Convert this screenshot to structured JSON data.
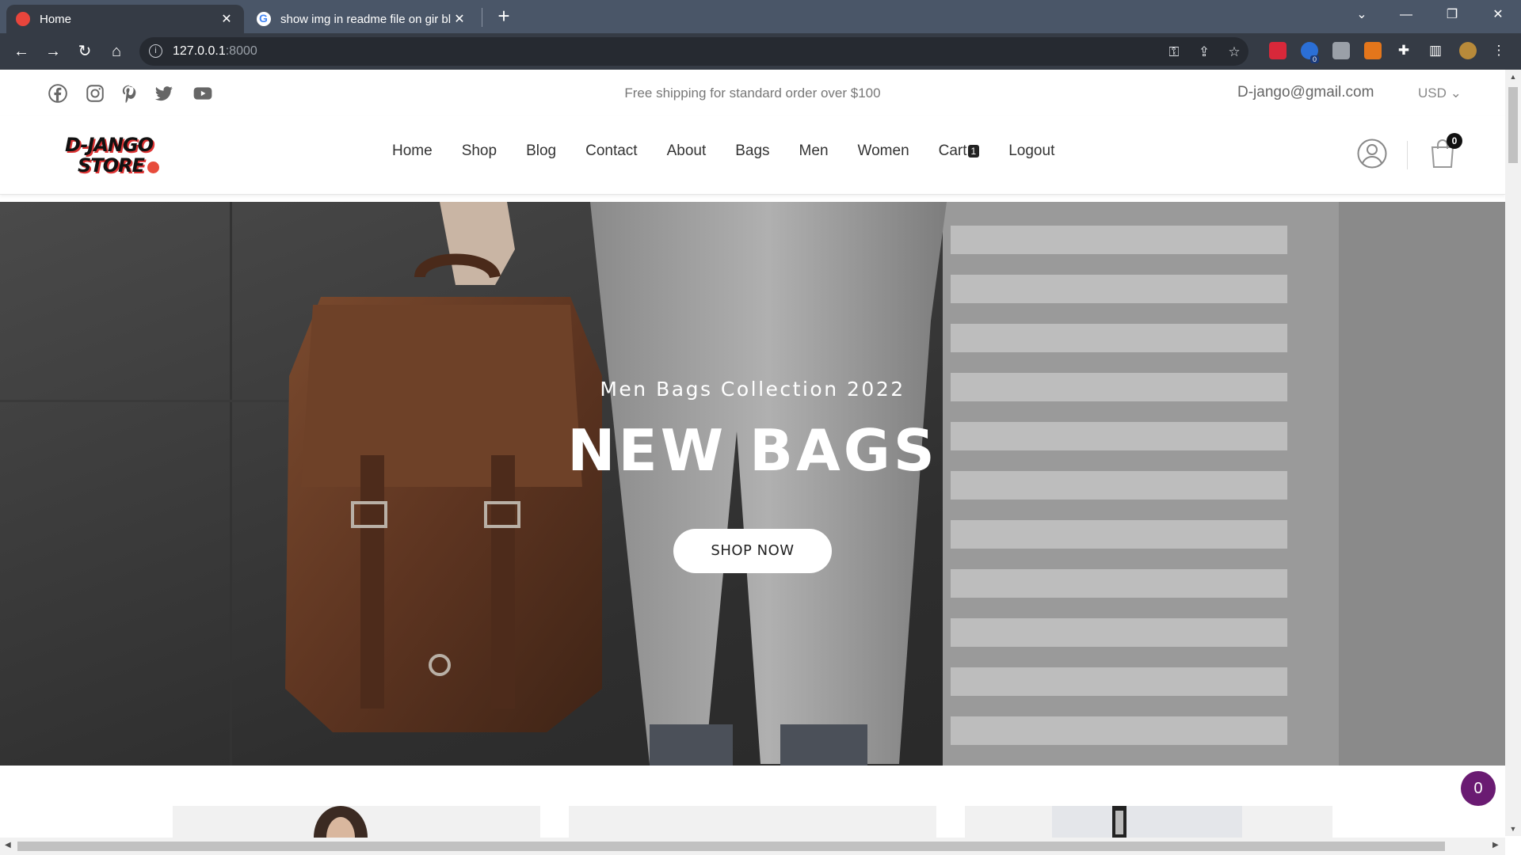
{
  "browser": {
    "tabs": [
      {
        "title": "Home",
        "active": true
      },
      {
        "title": "show img in readme file on gir bl",
        "active": false
      }
    ],
    "new_tab": "+",
    "address": {
      "host": "127.0.0.1",
      "port": ":8000"
    },
    "window_controls": {
      "minimize": "—",
      "restore": "❐",
      "close": "✕",
      "tab_search": "⌄"
    },
    "extension_badge": "0"
  },
  "topbar": {
    "social_icons": [
      "facebook-icon",
      "instagram-icon",
      "pinterest-icon",
      "twitter-icon",
      "youtube-icon"
    ],
    "shipping_text": "Free shipping for standard order over $100",
    "email": "D-jango@gmail.com",
    "currency": "USD ⌄"
  },
  "header": {
    "logo": {
      "line1": "D-JANGO",
      "line2": "STORE"
    },
    "nav": [
      {
        "label": "Home"
      },
      {
        "label": "Shop"
      },
      {
        "label": "Blog"
      },
      {
        "label": "Contact"
      },
      {
        "label": "About"
      },
      {
        "label": "Bags"
      },
      {
        "label": "Men"
      },
      {
        "label": "Women"
      },
      {
        "label": "Cart"
      },
      {
        "label": "Logout"
      }
    ],
    "cart_badge": "1",
    "bag_count": "0"
  },
  "hero": {
    "subtitle": "Men Bags Collection 2022",
    "title": "NEW BAGS",
    "button": "SHOP NOW"
  },
  "chat": {
    "count": "0"
  },
  "colors": {
    "accent_red": "#e74c3c",
    "chat_purple": "#6a1b72",
    "chrome_dark": "#353b45"
  }
}
